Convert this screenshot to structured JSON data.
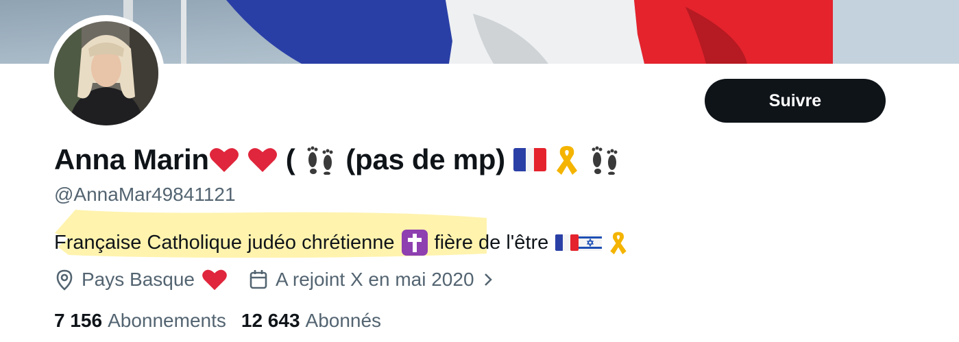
{
  "header": {
    "follow_label": "Suivre"
  },
  "profile": {
    "display_name": "Anna Marin",
    "display_name_mid": "(",
    "display_name_paren": "(pas de mp)",
    "handle": "@AnnaMar49841121",
    "bio_text": "Française Catholique judéo chrétienne",
    "bio_suffix": "fière de l'être",
    "location": "Pays Basque",
    "joined": "A rejoint X en mai 2020"
  },
  "stats": {
    "following_count": "7 156",
    "following_label": "Abonnements",
    "followers_count": "12 643",
    "followers_label": "Abonnés"
  },
  "colors": {
    "text_primary": "#0f1419",
    "text_secondary": "#536471",
    "button_bg": "#0f1419",
    "heart": "#e0263c",
    "ribbon": "#f4b400",
    "highlight": "#fff1a0",
    "flag_blue": "#2a3fa6",
    "flag_red": "#e4232d"
  },
  "icons": {
    "name_emojis": [
      "red-heart-icon",
      "red-heart-icon",
      "footprints-icon",
      "france-flag-icon",
      "yellow-ribbon-icon",
      "footprints-icon"
    ],
    "bio_emojis": [
      "latin-cross-icon",
      "france-flag-icon",
      "israel-flag-icon",
      "yellow-ribbon-icon"
    ],
    "location_icon": "map-pin-icon",
    "calendar_icon": "calendar-icon",
    "chevron_icon": "chevron-right-icon"
  }
}
